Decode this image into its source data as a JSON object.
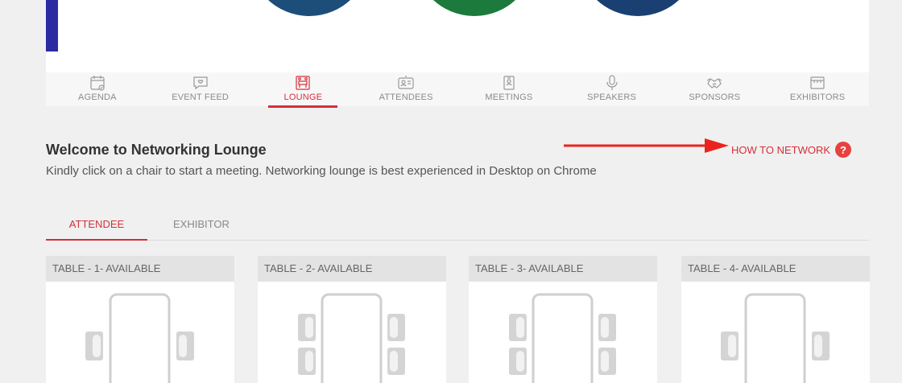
{
  "colors": {
    "accent": "#d62f3a",
    "banner_bar": "#2b2aa3"
  },
  "nav": {
    "items": [
      {
        "label": "AGENDA",
        "icon": "calendar-icon",
        "active": false
      },
      {
        "label": "EVENT FEED",
        "icon": "chat-bubble-icon",
        "active": false
      },
      {
        "label": "LOUNGE",
        "icon": "lounge-icon",
        "active": true
      },
      {
        "label": "ATTENDEES",
        "icon": "id-card-icon",
        "active": false
      },
      {
        "label": "MEETINGS",
        "icon": "badge-icon",
        "active": false
      },
      {
        "label": "SPEAKERS",
        "icon": "microphone-icon",
        "active": false
      },
      {
        "label": "SPONSORS",
        "icon": "handshake-icon",
        "active": false
      },
      {
        "label": "EXHIBITORS",
        "icon": "booth-icon",
        "active": false
      }
    ]
  },
  "lounge": {
    "title": "Welcome to Networking Lounge",
    "subtitle": "Kindly click on a chair to start a meeting. Networking lounge is best experienced in Desktop on Chrome",
    "how_to_network": "HOW TO NETWORK",
    "help_icon_glyph": "?"
  },
  "tabs": {
    "attendee": "ATTENDEE",
    "exhibitor": "EXHIBITOR",
    "active": "ATTENDEE"
  },
  "tables": [
    {
      "label": "TABLE - 1- AVAILABLE",
      "chairs": 2
    },
    {
      "label": "TABLE - 2- AVAILABLE",
      "chairs": 4
    },
    {
      "label": "TABLE - 3- AVAILABLE",
      "chairs": 4
    },
    {
      "label": "TABLE - 4- AVAILABLE",
      "chairs": 2
    }
  ]
}
